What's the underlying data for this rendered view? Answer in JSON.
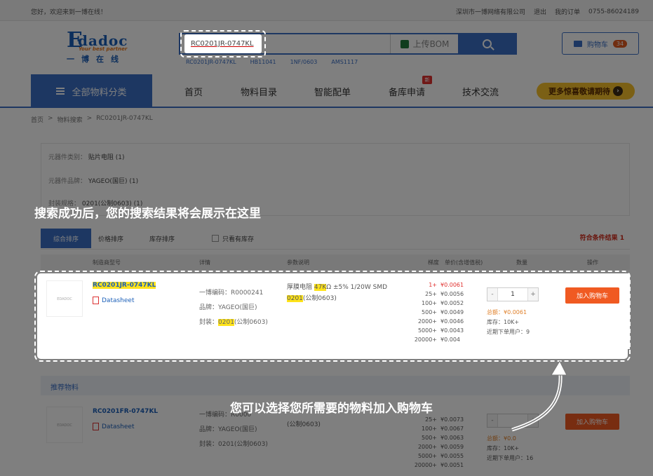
{
  "topbar": {
    "welcome": "您好，欢迎来到一博在线！",
    "company": "深圳市一博网络有限公司",
    "logout": "退出",
    "orders": "我的订单",
    "phone": "0755-86024189"
  },
  "logo": {
    "e": "E",
    "name": "dadoc",
    "slogan": "Your best partner",
    "cn": "一博在线"
  },
  "search": {
    "value": "RC0201JR-0747KL",
    "bom": "上传BOM",
    "hot": [
      "RC0201JR-0747KL",
      "HB11041",
      "1NF/0603",
      "AMS1117"
    ]
  },
  "cart": {
    "label": "购物车",
    "count": "34"
  },
  "nav": {
    "all": "全部物料分类",
    "items": [
      "首页",
      "物料目录",
      "智能配单",
      "备库申请",
      "技术交流"
    ],
    "new_tag": "新",
    "promo": "更多惊喜敬请期待"
  },
  "breadcrumb": [
    "首页",
    ">",
    "物料搜索",
    ">",
    "RC0201JR-0747KL"
  ],
  "filters": [
    {
      "label": "元器件类别：",
      "value": "贴片电阻",
      "count": "(1)"
    },
    {
      "label": "元器件品牌：",
      "value": "YAGEO(国巨)",
      "count": "(1)"
    },
    {
      "label": "封装规格：",
      "value": "0201(公制0603)",
      "count": "(1)"
    }
  ],
  "sort": {
    "items": [
      "综合排序",
      "价格排序",
      "库存排序"
    ],
    "only_stock": "只看有库存",
    "result": "符合条件结果 1"
  },
  "table_headers": [
    "制造商型号",
    "详情",
    "参数说明",
    "梯度",
    "单价(含增值税)",
    "数量",
    "操作"
  ],
  "product": {
    "pn": "RC0201JR-0747KL",
    "datasheet": "Datasheet",
    "code": "一博编码：R0000241",
    "brand": "品牌：YAGEO(国巨)",
    "pkg_prefix": "封装：",
    "pkg_hl": "0201",
    "pkg_rest": "(公制0603)",
    "param": {
      "a": "厚膜电阻 ",
      "b": "47K",
      "c": "Ω ±5% 1/20W SMD ",
      "d": "0201",
      "e": "(公制0603)"
    },
    "tiers": [
      [
        "1+",
        "¥0.0061"
      ],
      [
        "25+",
        "¥0.0056"
      ],
      [
        "100+",
        "¥0.0052"
      ],
      [
        "500+",
        "¥0.0049"
      ],
      [
        "2000+",
        "¥0.0046"
      ],
      [
        "5000+",
        "¥0.0043"
      ],
      [
        "20000+",
        "¥0.004"
      ]
    ],
    "qty": "1",
    "total": "总额：¥0.0061",
    "stock": "库存：10K+",
    "users": "近期下单用户：9",
    "add": "加入购物车"
  },
  "recommend": {
    "title": "推荐物料",
    "pn": "RC0201FR-0747KL",
    "datasheet": "Datasheet",
    "code": "一博编码：R0000",
    "brand": "品牌：YAGEO(国巨)",
    "pkg": "封装：0201(公制0603)",
    "param": "(公制0603)",
    "tiers": [
      [
        "25+",
        "¥0.0073"
      ],
      [
        "100+",
        "¥0.0067"
      ],
      [
        "500+",
        "¥0.0063"
      ],
      [
        "2000+",
        "¥0.0059"
      ],
      [
        "5000+",
        "¥0.0055"
      ],
      [
        "20000+",
        "¥0.0051"
      ]
    ],
    "total": "总额：¥0.0",
    "stock": "库存：10K+",
    "users": "近期下单用户：16",
    "add": "加入购物车"
  },
  "captions": {
    "one": "搜索成功后，您的搜索结果将会展示在这里",
    "two": "您可以选择您所需要的物料加入购物车"
  }
}
